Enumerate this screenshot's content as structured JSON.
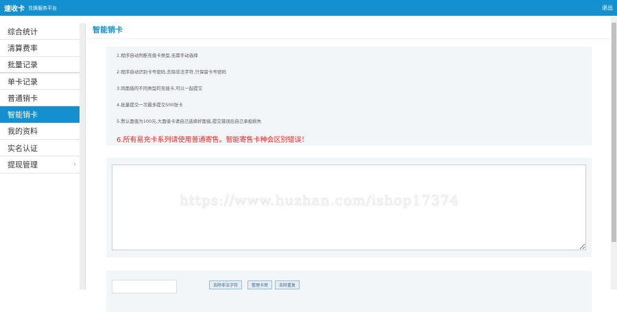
{
  "header": {
    "logo": "速收卡",
    "subtitle": "兑换服务平台",
    "logout": "退出"
  },
  "sidebar": {
    "items": [
      {
        "label": "综合统计"
      },
      {
        "label": "清算费率"
      },
      {
        "label": "批量记录"
      },
      {
        "label": "单卡记录"
      },
      {
        "label": "普通销卡"
      },
      {
        "label": "智能销卡"
      },
      {
        "label": "我的资料"
      },
      {
        "label": "实名认证"
      },
      {
        "label": "提现管理",
        "arrow": "›"
      }
    ]
  },
  "page": {
    "title": "智能销卡"
  },
  "notice": [
    "1.程序自动判断充值卡类型,无需手动选择",
    "2.程序自动识别卡号密码,去除非法字符,只保留卡号密码",
    "3.同面值的不同类型的充值卡,可以一起提交",
    "4.批量提交一次最多提交500张卡",
    "5.默认面值为100元,大面值卡请自己选择好面值,提交错误后自己承担损失",
    "6.所有易充卡系列请使用普通寄售。智能寄售卡种会区别错误！"
  ],
  "watermark": "https://www.huzhan.com/ishop17374",
  "buttons": [
    "去除非法字符",
    "整理卡密",
    "去除重复"
  ]
}
